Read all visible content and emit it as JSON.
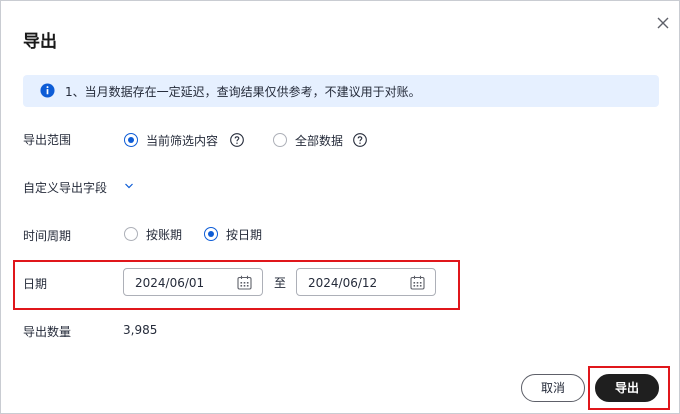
{
  "dialog": {
    "title": "导出",
    "notice": "1、当月数据存在一定延迟，查询结果仅供参考，不建议用于对账。"
  },
  "scope": {
    "label": "导出范围",
    "options": [
      {
        "label": "当前筛选内容",
        "selected": true
      },
      {
        "label": "全部数据",
        "selected": false
      }
    ]
  },
  "custom_fields": {
    "label": "自定义导出字段"
  },
  "period": {
    "label": "时间周期",
    "options": [
      {
        "label": "按账期",
        "selected": false
      },
      {
        "label": "按日期",
        "selected": true
      }
    ]
  },
  "date": {
    "label": "日期",
    "start": "2024/06/01",
    "separator": "至",
    "end": "2024/06/12"
  },
  "count": {
    "label": "导出数量",
    "value": "3,985"
  },
  "buttons": {
    "cancel": "取消",
    "export": "导出"
  },
  "colors": {
    "accent": "#0d5cd6",
    "notice_bg": "#e6f0ff",
    "highlight": "#e0161b",
    "primary_button": "#1f1f1f"
  },
  "icons": [
    "close-icon",
    "info-icon",
    "help-icon",
    "chevron-down-icon",
    "calendar-icon"
  ]
}
